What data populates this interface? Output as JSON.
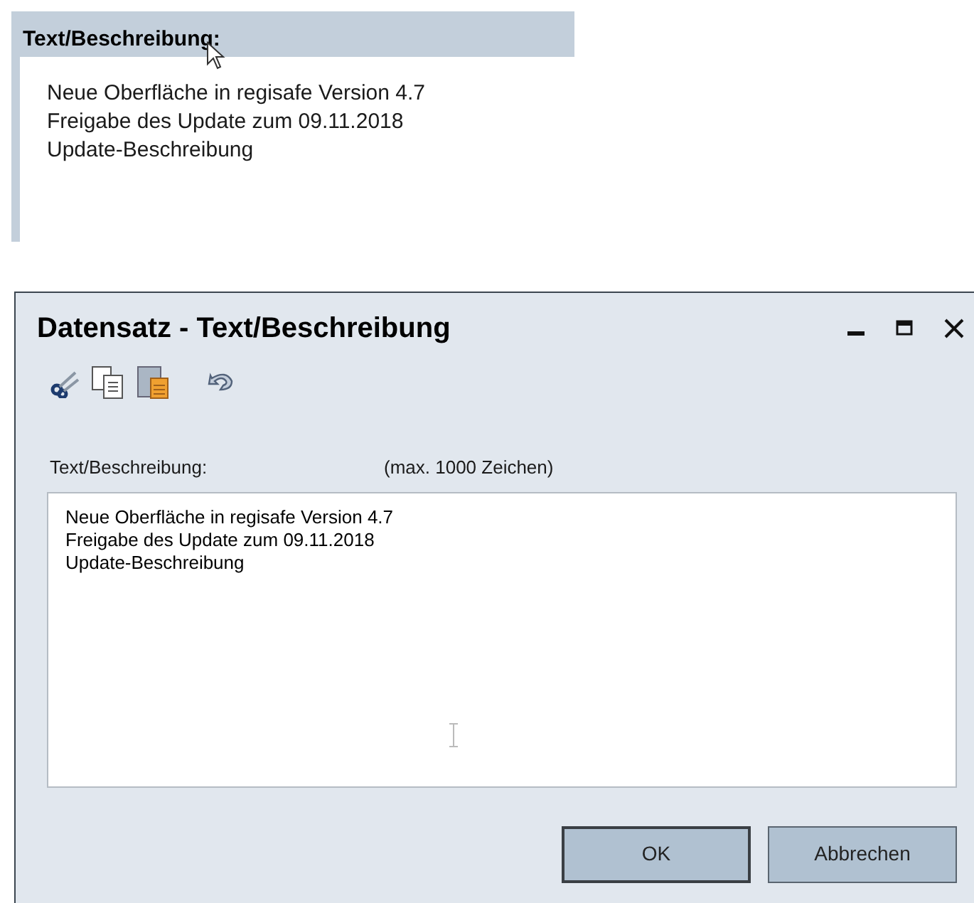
{
  "preview": {
    "label": "Text/Beschreibung:",
    "lines": [
      "Neue Oberfläche in regisafe Version 4.7",
      "Freigabe des Update zum 09.11.2018",
      "Update-Beschreibung"
    ]
  },
  "dialog": {
    "title": "Datensatz - Text/Beschreibung",
    "field": {
      "label": "Text/Beschreibung:",
      "hint": "(max. 1000 Zeichen)",
      "lines": [
        "Neue Oberfläche in regisafe Version 4.7",
        "Freigabe des Update zum 09.11.2018",
        "Update-Beschreibung"
      ]
    },
    "buttons": [
      "OK",
      "Abbrechen"
    ]
  }
}
